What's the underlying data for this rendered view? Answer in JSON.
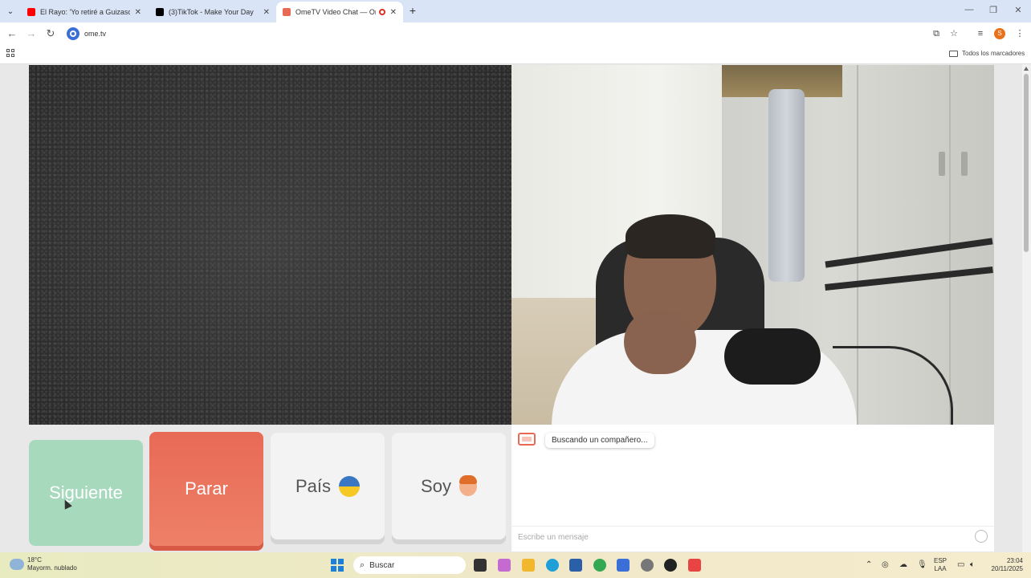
{
  "browser": {
    "tabs": [
      {
        "title": "El Rayo: 'Yo retiré a Guizasola",
        "favicon_color": "#ff0000",
        "active": false
      },
      {
        "title": "(3)TikTok - Make Your Day",
        "favicon_color": "#000000",
        "active": false
      },
      {
        "title": "OmeTV Video Chat — Ome",
        "favicon_color": "#e86a55",
        "active": true
      }
    ],
    "url": "ome.tv",
    "profile_initial": "S",
    "bookmarks_folder": "Todos los marcadores"
  },
  "controls": {
    "next_label": "Siguiente",
    "stop_label": "Parar",
    "country_label": "País",
    "gender_label": "Soy"
  },
  "chat": {
    "status_message": "Buscando un compañero...",
    "input_placeholder": "Escribe un mensaje"
  },
  "taskbar": {
    "weather_temp": "18°C",
    "weather_desc": "Mayorm. nublado",
    "search_label": "Buscar",
    "language": "ESP",
    "layout": "LAA",
    "time": "23:04",
    "date": "20/11/2025"
  },
  "colors": {
    "next_button": "#a7d9bd",
    "stop_button": "#e86a55",
    "tab_strip": "#d9e4f7"
  }
}
